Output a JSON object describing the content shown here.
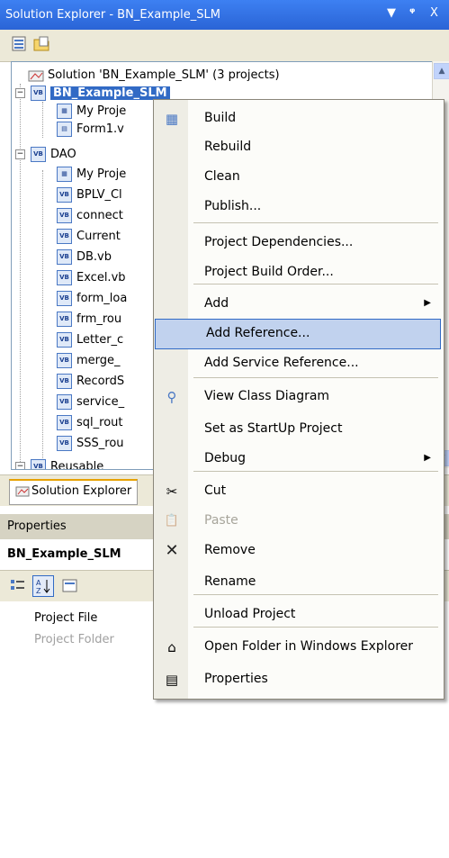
{
  "title_bar": {
    "title": "Solution Explorer - BN_Example_SLM",
    "dropdown_glyph": "▼",
    "pin_glyph": "ᵠ",
    "close_glyph": "X"
  },
  "toolbar": {
    "icons": [
      "properties-icon",
      "show-all-files-icon"
    ]
  },
  "tree": {
    "solution_label": "Solution 'BN_Example_SLM' (3 projects)",
    "project1": "BN_Example_SLM",
    "project1_items": [
      "My Proje",
      "Form1.v"
    ],
    "project2": "DAO",
    "project2_items": [
      "My Proje",
      "BPLV_Cl",
      "connect",
      "Current",
      "DB.vb",
      "Excel.vb",
      "form_loa",
      "frm_rou",
      "Letter_c",
      "merge_",
      "RecordS",
      "service_",
      "sql_rout",
      "SSS_rou"
    ],
    "project3": "Reusable",
    "expand_minus": "−"
  },
  "tabs": {
    "solution_explorer": "Solution Explorer"
  },
  "properties": {
    "header": "Properties",
    "object": "BN_Example_SLM",
    "rows": [
      {
        "name": "Project File"
      },
      {
        "name": "Project Folder"
      }
    ]
  },
  "context_menu": {
    "items": [
      {
        "label": "Build",
        "icon": "build-icon"
      },
      {
        "label": "Rebuild"
      },
      {
        "label": "Clean"
      },
      {
        "label": "Publish..."
      },
      {
        "label": "Project Dependencies..."
      },
      {
        "label": "Project Build Order..."
      },
      {
        "label": "Add",
        "submenu": true
      },
      {
        "label": "Add Reference...",
        "highlighted": true
      },
      {
        "label": "Add Service Reference..."
      },
      {
        "label": "View Class Diagram",
        "icon": "class-diagram-icon"
      },
      {
        "label": "Set as StartUp Project"
      },
      {
        "label": "Debug",
        "submenu": true
      },
      {
        "label": "Cut",
        "icon": "scissors-icon"
      },
      {
        "label": "Paste",
        "icon": "paste-icon",
        "disabled": true
      },
      {
        "label": "Remove",
        "icon": "remove-x-icon"
      },
      {
        "label": "Rename"
      },
      {
        "label": "Unload Project"
      },
      {
        "label": "Open Folder in Windows Explorer",
        "icon": "open-folder-icon"
      },
      {
        "label": "Properties",
        "icon": "properties-icon"
      }
    ],
    "submenu_arrow": "▶"
  },
  "colors": {
    "title_bar": "#2a64d6",
    "highlight": "#c1d2ee",
    "highlight_border": "#316ac5"
  }
}
